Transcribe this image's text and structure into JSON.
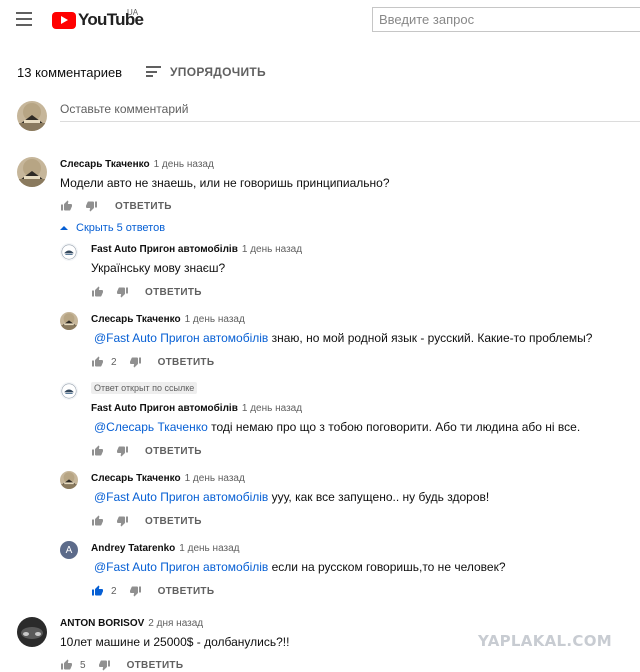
{
  "header": {
    "brand": "YouTube",
    "region": "UA",
    "search_placeholder": "Введите запрос"
  },
  "comments_header": {
    "count_label": "13 комментариев",
    "sort_label": "УПОРЯДОЧИТЬ",
    "add_placeholder": "Оставьте комментарий"
  },
  "labels": {
    "reply": "ОТВЕТИТЬ",
    "hide_replies": "Скрыть 5 ответов",
    "pinned": "Ответ открыт по ссылке"
  },
  "comments": [
    {
      "author": "Слесарь Ткаченко",
      "time": "1 день назад",
      "text": "Модели авто не знаешь, или не говоришь принципиально?",
      "likes": ""
    },
    {
      "author": "Fast Auto Пригон автомобілів",
      "time": "1 день назад",
      "text": "Українську мову знаєш?",
      "likes": ""
    },
    {
      "author": "Слесарь Ткаченко",
      "time": "1 день назад",
      "mention": "@Fast Auto Пригон автомобілів",
      "text": " знаю, но мой родной язык - русский. Какие-то проблемы?",
      "likes": "2"
    },
    {
      "author": "Fast Auto Пригон автомобілів",
      "time": "1 день назад",
      "mention": "@Слесарь Ткаченко",
      "text": " тоді немаю про що з тобою поговорити. Або ти людина або ні все.",
      "likes": ""
    },
    {
      "author": "Слесарь Ткаченко",
      "time": "1 день назад",
      "mention": "@Fast Auto Пригон автомобілів",
      "text": " ууу, как все запущено.. ну будь здоров!",
      "likes": ""
    },
    {
      "author": "Andrey Tatarenko",
      "time": "1 день назад",
      "avatar_letter": "A",
      "mention": "@Fast Auto Пригон автомобілів",
      "text": " если на русском говоришь,то не человек?",
      "likes": "2"
    },
    {
      "author": "ANTON BORISOV",
      "time": "2 дня назад",
      "text": "10лет машине и 25000$ - долбанулись?!!",
      "likes": "5"
    }
  ],
  "watermark": "YAPLAKAL.COM",
  "colors": {
    "brand_red": "#ff0000",
    "link_blue": "#065fd4",
    "muted": "#606060"
  }
}
